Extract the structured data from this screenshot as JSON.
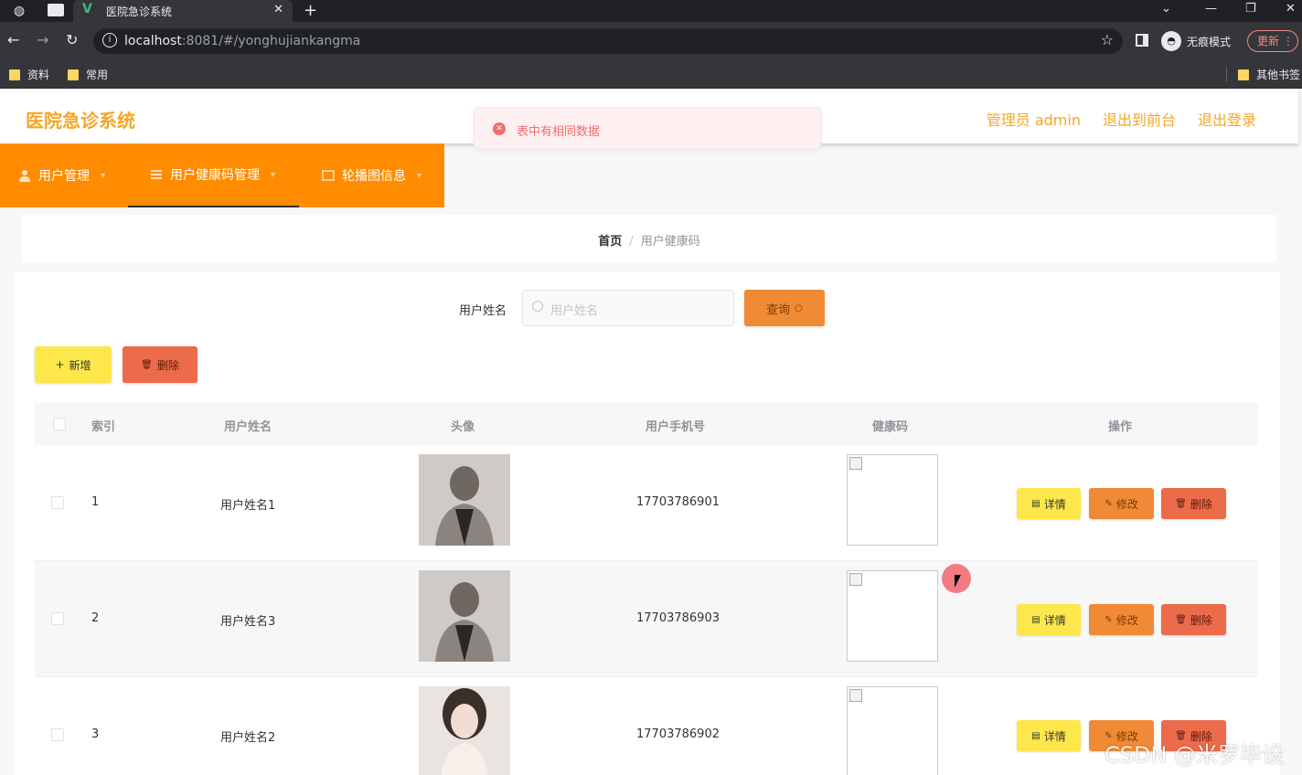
{
  "browser": {
    "tab_title": "医院急诊系统",
    "url_host": "localhost",
    "url_rest": ":8081/#/yonghujiankangma",
    "incognito_label": "无痕模式",
    "update_label": "更新",
    "bookmarks": [
      "资料",
      "常用",
      "其他书签"
    ]
  },
  "header": {
    "logo": "医院急诊系统",
    "admin_link": "管理员 admin",
    "frontend_link": "退出到前台",
    "logout_link": "退出登录"
  },
  "toast": {
    "message": "表中有相同数据",
    "type": "error",
    "color": "#f56c6c"
  },
  "menu": {
    "items": [
      {
        "label": "用户管理"
      },
      {
        "label": "用户健康码管理",
        "active": true
      },
      {
        "label": "轮播图信息"
      }
    ],
    "color": "#ff8c00"
  },
  "breadcrumb": {
    "home": "首页",
    "separator": "/",
    "current": "用户健康码"
  },
  "search": {
    "label": "用户姓名",
    "placeholder": "用户姓名",
    "query_button": "查询"
  },
  "actions": {
    "add_button": "新增",
    "delete_button": "删除"
  },
  "table": {
    "headers": [
      "索引",
      "用户姓名",
      "头像",
      "用户手机号",
      "健康码",
      "操作"
    ],
    "rows": [
      {
        "index": "1",
        "name": "用户姓名1",
        "phone": "17703786901"
      },
      {
        "index": "2",
        "name": "用户姓名3",
        "phone": "17703786903"
      },
      {
        "index": "3",
        "name": "用户姓名2",
        "phone": "17703786902"
      }
    ],
    "row_actions": {
      "detail": "详情",
      "edit": "修改",
      "delete": "删除"
    }
  },
  "watermark": "CSDN @米罗毕设"
}
